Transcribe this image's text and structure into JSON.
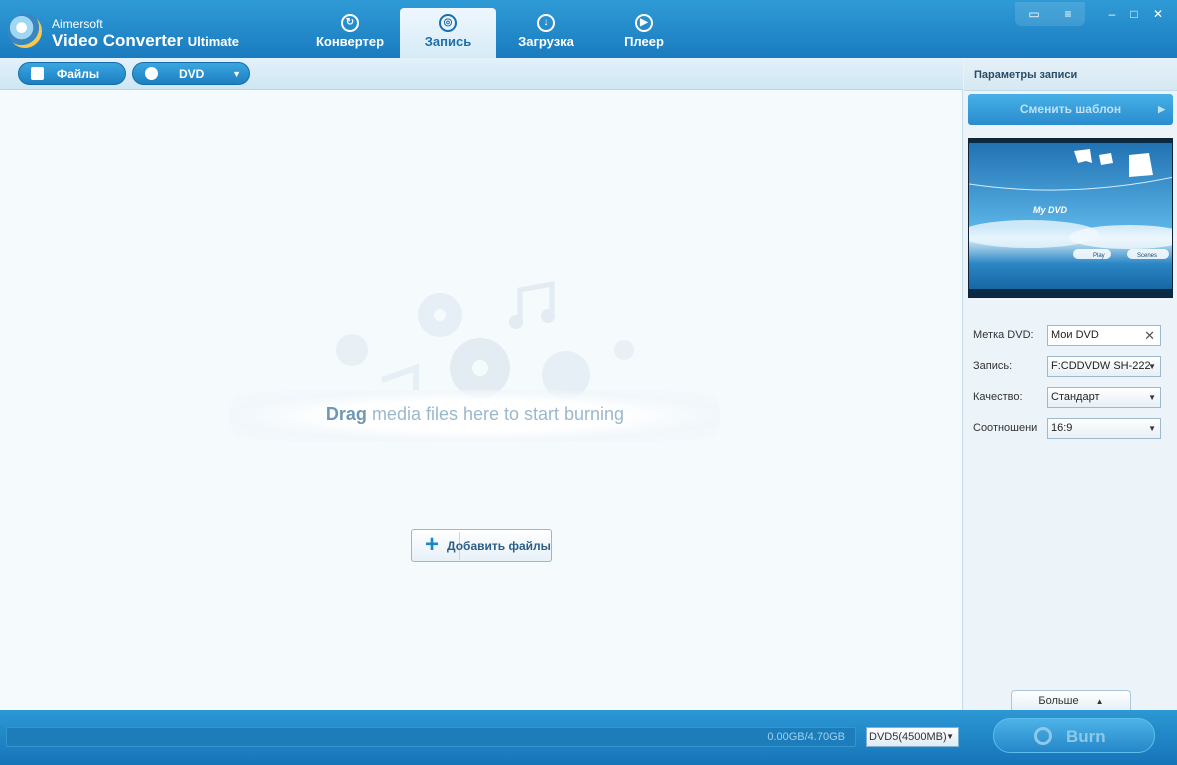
{
  "app": {
    "brand_line1": "Aimersoft",
    "brand_line2": "Video Converter",
    "brand_suffix": "Ultimate"
  },
  "tabs": [
    {
      "label": "Конвертер",
      "icon": "convert-icon"
    },
    {
      "label": "Запись",
      "icon": "burn-disc-icon",
      "active": true
    },
    {
      "label": "Загрузка",
      "icon": "download-icon"
    },
    {
      "label": "Плеер",
      "icon": "play-icon"
    }
  ],
  "window_controls": {
    "icons": [
      "chat-icon",
      "menu-icon",
      "minimize-icon",
      "maximize-icon",
      "close-icon"
    ]
  },
  "toolbar": {
    "files_label": "Файлы",
    "dvd_label": "DVD"
  },
  "main": {
    "drag_bold": "Drag",
    "drag_rest": "media files here to start burning",
    "add_files_label": "Добавить файлы"
  },
  "settings": {
    "title": "Параметры записи",
    "change_template_label": "Сменить шаблон",
    "preview": {
      "title": "My DVD",
      "play_label": "Play",
      "scenes_label": "Scenes"
    },
    "fields": {
      "dvd_label_label": "Метка DVD:",
      "dvd_label_value": "Мои DVD",
      "burn_label": "Запись:",
      "burn_value": "F:CDDVDW SH-222",
      "quality_label": "Качество:",
      "quality_value": "Стандарт",
      "ratio_label": "Соотношени",
      "ratio_value": "16:9"
    },
    "more_label": "Больше"
  },
  "bottom": {
    "capacity_text": "0.00GB/4.70GB",
    "progress_fraction": 0,
    "disc_type": "DVD5(4500MB)",
    "burn_label": "Burn"
  },
  "colors": {
    "accent": "#1a7bbf",
    "panel_bg": "#f5fafd"
  }
}
